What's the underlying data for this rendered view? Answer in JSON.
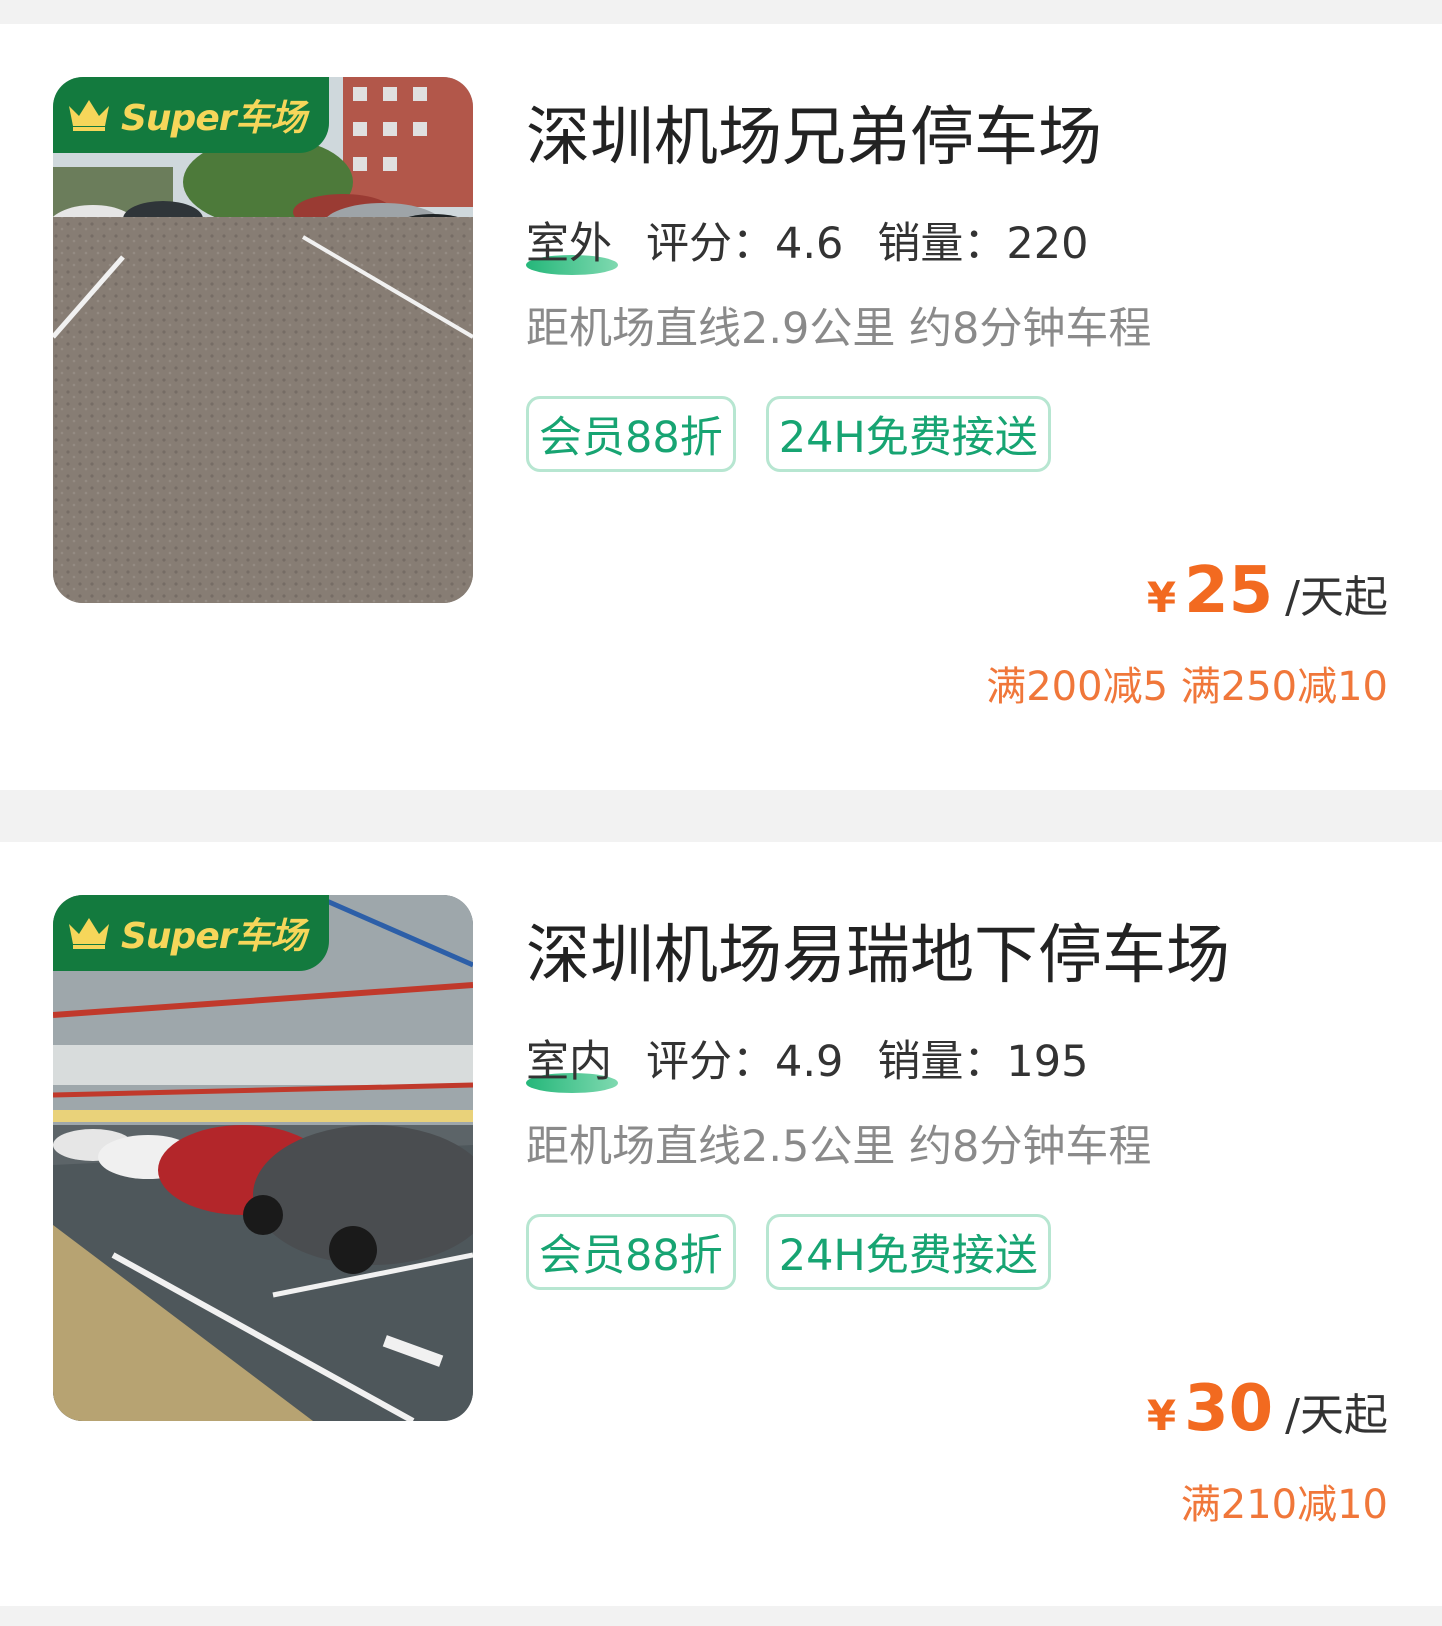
{
  "colors": {
    "brand_green": "#137a3e",
    "badge_text": "#f6d65a",
    "tag_green": "#17a472",
    "price_orange": "#f26a20",
    "promo_orange": "#f0773a"
  },
  "lots": [
    {
      "badge": "Super车场",
      "image": "outdoor-parking-lot-photo",
      "name": "深圳机场兄弟停车场",
      "environment": "室外",
      "rating_label": "评分：4.6",
      "sales_label": "销量：220",
      "distance": "距机场直线2.9公里 约8分钟车程",
      "tags": [
        "会员88折",
        "24H免费接送"
      ],
      "currency": "¥",
      "price": "25",
      "price_unit": "/天起",
      "promo": "满200减5 满250减10"
    },
    {
      "badge": "Super车场",
      "image": "underground-parking-garage-photo",
      "name": "深圳机场易瑞地下停车场",
      "environment": "室内",
      "rating_label": "评分：4.9",
      "sales_label": "销量：195",
      "distance": "距机场直线2.5公里 约8分钟车程",
      "tags": [
        "会员88折",
        "24H免费接送"
      ],
      "currency": "¥",
      "price": "30",
      "price_unit": "/天起",
      "promo": "满210减10"
    }
  ]
}
